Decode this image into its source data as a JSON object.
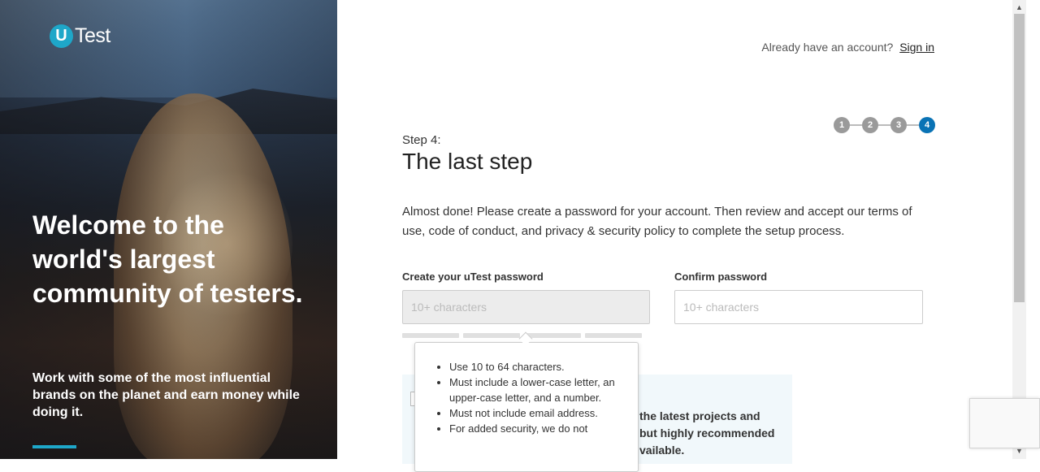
{
  "brand": {
    "logo_letter": "U",
    "logo_text": "Test",
    "accent": "#1ea7c9"
  },
  "hero": {
    "title": "Welcome to the world's largest community of testers.",
    "subtitle": "Work with some of the most influential brands on the planet and earn money while doing it."
  },
  "header": {
    "account_prompt": "Already have an account?",
    "signin_label": "Sign in"
  },
  "stepper": {
    "steps": [
      "1",
      "2",
      "3",
      "4"
    ],
    "active_step": "4"
  },
  "form": {
    "step_label": "Step 4:",
    "title": "The last step",
    "intro": "Almost done! Please create a password for your account. Then review and accept our terms of use, code of conduct, and privacy & security policy to complete the setup process.",
    "password_label": "Create your uTest password",
    "password_placeholder": "10+ characters",
    "confirm_label": "Confirm password",
    "confirm_placeholder": "10+ characters"
  },
  "tooltip": {
    "rules": [
      "Use 10 to 64 characters.",
      "Must include a lower-case letter, an upper-case letter, and a number.",
      "Must not include email address.",
      "For added security, we do not"
    ]
  },
  "info": {
    "lines": [
      "the latest projects and",
      "but highly recommended",
      "vailable."
    ]
  }
}
